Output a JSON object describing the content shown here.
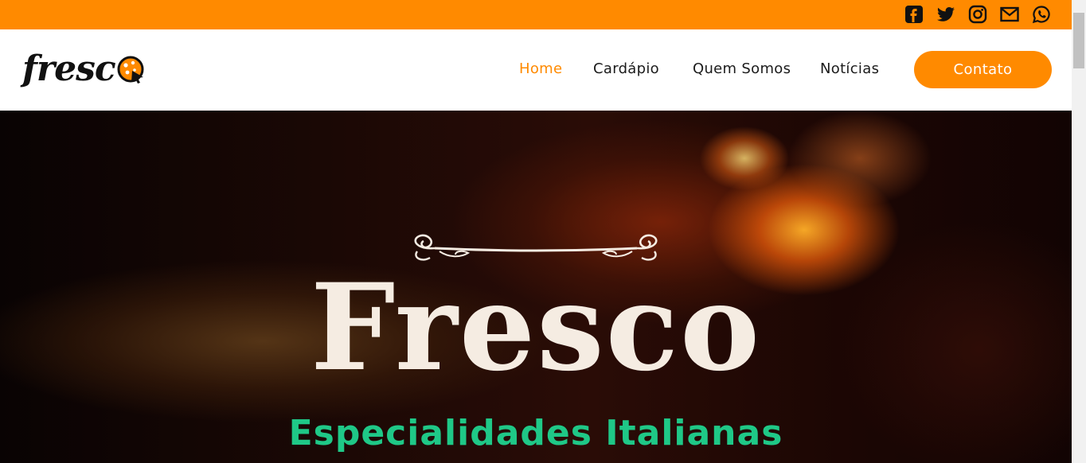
{
  "colors": {
    "accent": "#ff8a00",
    "subtitle": "#1fc887",
    "title": "#f5ece2",
    "nav_text": "#1b1b1b"
  },
  "social": [
    {
      "icon": "facebook-icon"
    },
    {
      "icon": "twitter-icon"
    },
    {
      "icon": "instagram-icon"
    },
    {
      "icon": "email-icon"
    },
    {
      "icon": "whatsapp-icon"
    }
  ],
  "logo": {
    "text": "fresc",
    "icon": "pizza-icon"
  },
  "nav": {
    "items": [
      {
        "label": "Home",
        "active": true
      },
      {
        "label": "Cardápio",
        "active": false
      },
      {
        "label": "Quem Somos",
        "active": false
      },
      {
        "label": "Notícias",
        "active": false
      }
    ],
    "contact_label": "Contato"
  },
  "hero": {
    "title": "Fresco",
    "subtitle": "Especialidades Italianas",
    "ornament_icon": "flourish-ornament"
  }
}
